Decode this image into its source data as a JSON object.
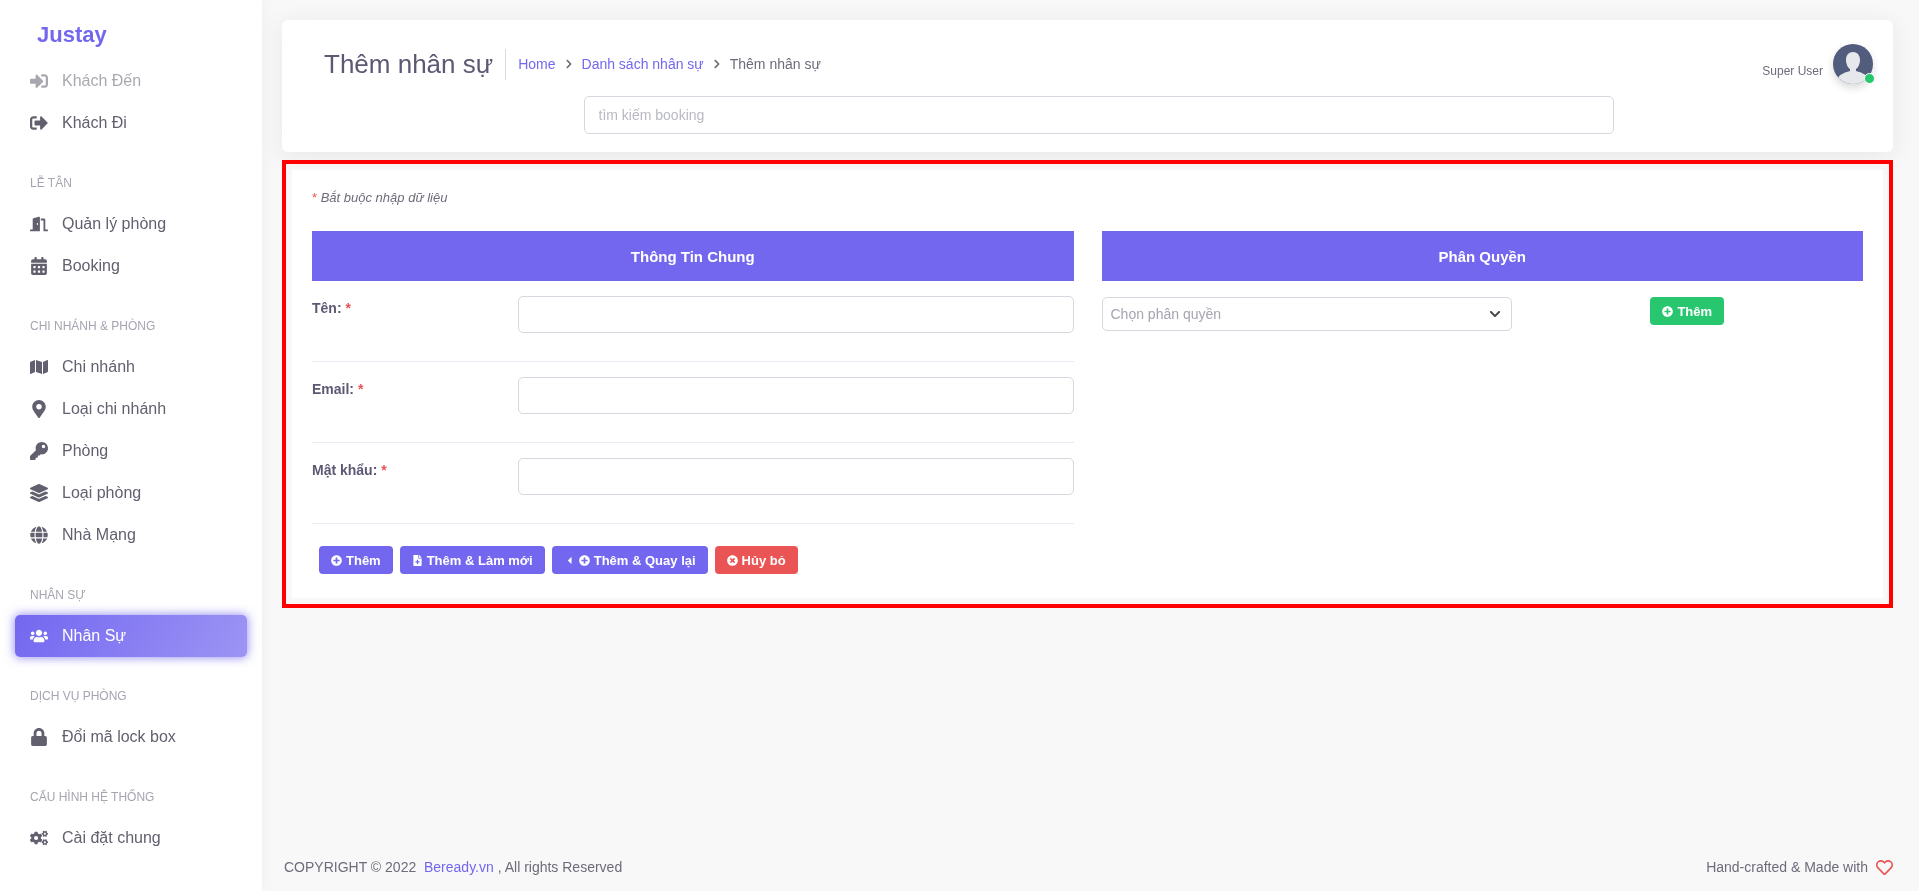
{
  "sidebar": {
    "brand": "Justay",
    "sections": [
      {
        "items": [
          {
            "label": "Khách Đến",
            "faded": true,
            "selected": false
          },
          {
            "label": "Khách Đi",
            "faded": false,
            "selected": false
          }
        ]
      },
      {
        "heading": "LỄ TÂN",
        "items": [
          {
            "label": "Quản lý phòng",
            "faded": false,
            "selected": false
          },
          {
            "label": "Booking",
            "faded": false,
            "selected": false
          }
        ]
      },
      {
        "heading": "CHI NHÁNH & PHÒNG",
        "items": [
          {
            "label": "Chi nhánh",
            "faded": false,
            "selected": false
          },
          {
            "label": "Loại chi nhánh",
            "faded": false,
            "selected": false
          },
          {
            "label": "Phòng",
            "faded": false,
            "selected": false
          },
          {
            "label": "Loại phòng",
            "faded": false,
            "selected": false
          },
          {
            "label": "Nhà Mạng",
            "faded": false,
            "selected": false
          }
        ]
      },
      {
        "heading": "NHÂN SỰ",
        "items": [
          {
            "label": "Nhân Sự",
            "faded": false,
            "selected": true
          }
        ]
      },
      {
        "heading": "DỊCH VỤ PHÒNG",
        "items": [
          {
            "label": "Đổi mã lock box",
            "faded": false,
            "selected": false
          }
        ]
      },
      {
        "heading": "CẤU HÌNH HỆ THỐNG",
        "items": [
          {
            "label": "Cài đặt chung",
            "faded": false,
            "selected": false
          }
        ]
      }
    ]
  },
  "header": {
    "title": "Thêm nhân sự",
    "breadcrumb": [
      {
        "label": "Home",
        "link": true
      },
      {
        "label": "Danh sách nhân sự",
        "link": true
      },
      {
        "label": "Thêm nhân sự",
        "link": false
      }
    ],
    "search": {
      "placeholder": "tìm kiếm booking"
    },
    "user": {
      "name": "Super User",
      "online": true
    }
  },
  "form": {
    "required_note": {
      "mark": "*",
      "text": "Bắt buộc nhập dữ liệu"
    },
    "general": {
      "heading": "Thông Tin Chung",
      "fields": [
        {
          "label": "Tên:",
          "mark": "*"
        },
        {
          "label": "Email:",
          "mark": "*"
        },
        {
          "label": "Mật khẩu:",
          "mark": "*"
        }
      ],
      "buttons": [
        {
          "label": "Thêm",
          "kind": "add"
        },
        {
          "label": "Thêm & Làm mới",
          "kind": "add-new"
        },
        {
          "label": "Thêm & Quay lại",
          "kind": "add-back"
        },
        {
          "label": "Hủy bỏ",
          "kind": "cancel"
        }
      ]
    },
    "permissions": {
      "heading": "Phân Quyền",
      "select": {
        "placeholder": "Chọn phân quyền"
      },
      "add_button": "Thêm"
    }
  },
  "footer": {
    "copyright": "COPYRIGHT © 2022",
    "link": "Beready.vn",
    "rights": ", All rights Reserved",
    "credit": "Hand-crafted & Made with"
  }
}
